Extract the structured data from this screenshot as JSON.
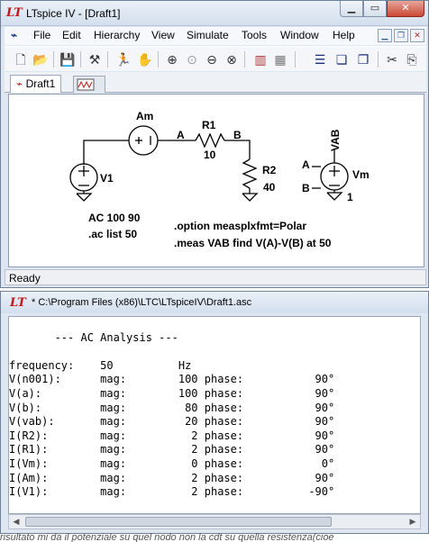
{
  "window": {
    "logo": "LT",
    "title": "LTspice IV - [Draft1]",
    "minimize": "▁",
    "maximize": "▭",
    "close": "✕"
  },
  "menu": [
    {
      "label": "File"
    },
    {
      "label": "Edit"
    },
    {
      "label": "Hierarchy"
    },
    {
      "label": "View"
    },
    {
      "label": "Simulate"
    },
    {
      "label": "Tools"
    },
    {
      "label": "Window"
    },
    {
      "label": "Help"
    }
  ],
  "tabs": [
    {
      "label": "Draft1"
    }
  ],
  "schematic": {
    "ammeter": "Am",
    "source_v1": "V1",
    "resistor_r1": "R1",
    "r1_value": "10",
    "resistor_r2": "R2",
    "r2_value": "40",
    "node_a": "A",
    "node_b": "B",
    "vm_label": "Vm",
    "vab_label": "VAB",
    "vm_a": "A",
    "vm_b": "B",
    "vm_value": "1",
    "ac_directive": "AC 100 90",
    "ac_list": ".ac list   50",
    "option_directive": ".option measplxfmt=Polar",
    "meas_directive": ".meas VAB  find V(A)-V(B) at 50"
  },
  "status": "Ready",
  "output": {
    "title": "* C:\\Program Files (x86)\\LTC\\LTspiceIV\\Draft1.asc",
    "lines": [
      "",
      "       --- AC Analysis ---",
      "",
      "frequency:    50          Hz",
      "V(n001):      mag:        100 phase:           90°",
      "V(a):         mag:        100 phase:           90°",
      "V(b):         mag:         80 phase:           90°",
      "V(vab):       mag:         20 phase:           90°",
      "I(R2):        mag:          2 phase:           90°",
      "I(R1):        mag:          2 phase:           90°",
      "I(Vm):        mag:          0 phase:            0°",
      "I(Am):        mag:          2 phase:           90°",
      "I(V1):        mag:          2 phase:          -90°"
    ]
  },
  "footer_text": "risultato mi da il potenziale su quel nodo non la cdt su quella resistenza(cioe"
}
